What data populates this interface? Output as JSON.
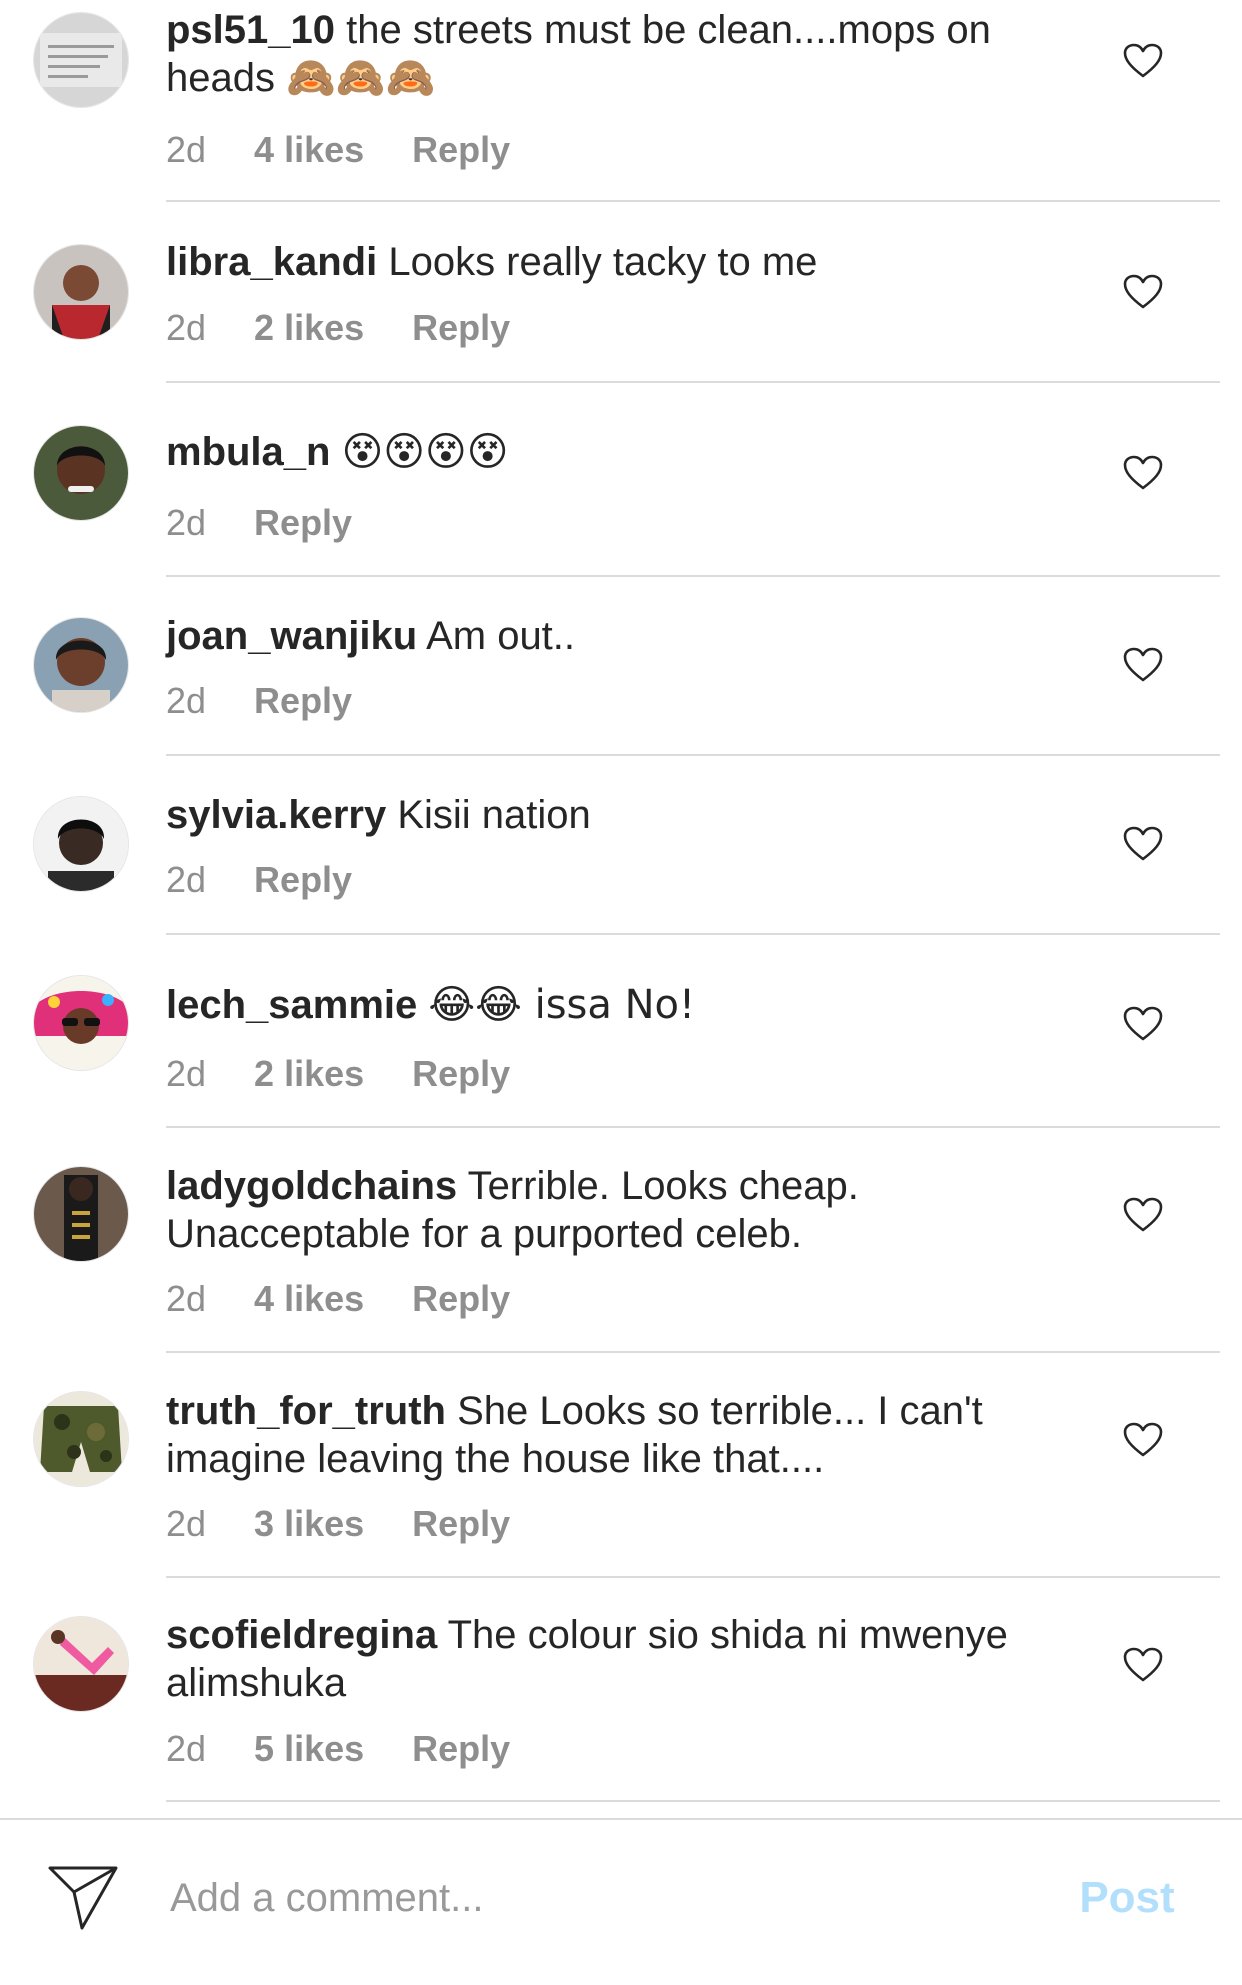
{
  "comments": [
    {
      "username": "psl51_10",
      "text": "the streets must be clean....mops on heads 🙈🙈🙈",
      "time": "2d",
      "likes": "4 likes",
      "reply": "Reply"
    },
    {
      "username": "libra_kandi",
      "text": "Looks really tacky to me",
      "time": "2d",
      "likes": "2 likes",
      "reply": "Reply"
    },
    {
      "username": "mbula_n",
      "text": "😵😵😵😵",
      "time": "2d",
      "likes": null,
      "reply": "Reply"
    },
    {
      "username": "joan_wanjiku",
      "text": "Am out..",
      "time": "2d",
      "likes": null,
      "reply": "Reply"
    },
    {
      "username": "sylvia.kerry",
      "text": "Kisii nation",
      "time": "2d",
      "likes": null,
      "reply": "Reply"
    },
    {
      "username": "lech_sammie",
      "text": "😂😂 issa No!",
      "time": "2d",
      "likes": "2 likes",
      "reply": "Reply"
    },
    {
      "username": "ladygoldchains",
      "text": "Terrible. Looks cheap. Unacceptable for a purported celeb.",
      "time": "2d",
      "likes": "4 likes",
      "reply": "Reply"
    },
    {
      "username": "truth_for_truth",
      "text": "She Looks so terrible... I can't imagine leaving the house like that....",
      "time": "2d",
      "likes": "3 likes",
      "reply": "Reply"
    },
    {
      "username": "scofieldregina",
      "text": "The colour sio shida ni mwenye alimshuka",
      "time": "2d",
      "likes": "5 likes",
      "reply": "Reply"
    }
  ],
  "comment_bar": {
    "placeholder": "Add a comment...",
    "post_label": "Post",
    "icon": "send-icon"
  },
  "colors": {
    "text": "#262626",
    "meta": "#8e8e8e",
    "divider": "#dbdbdb",
    "post_disabled": "#b2dffc"
  }
}
